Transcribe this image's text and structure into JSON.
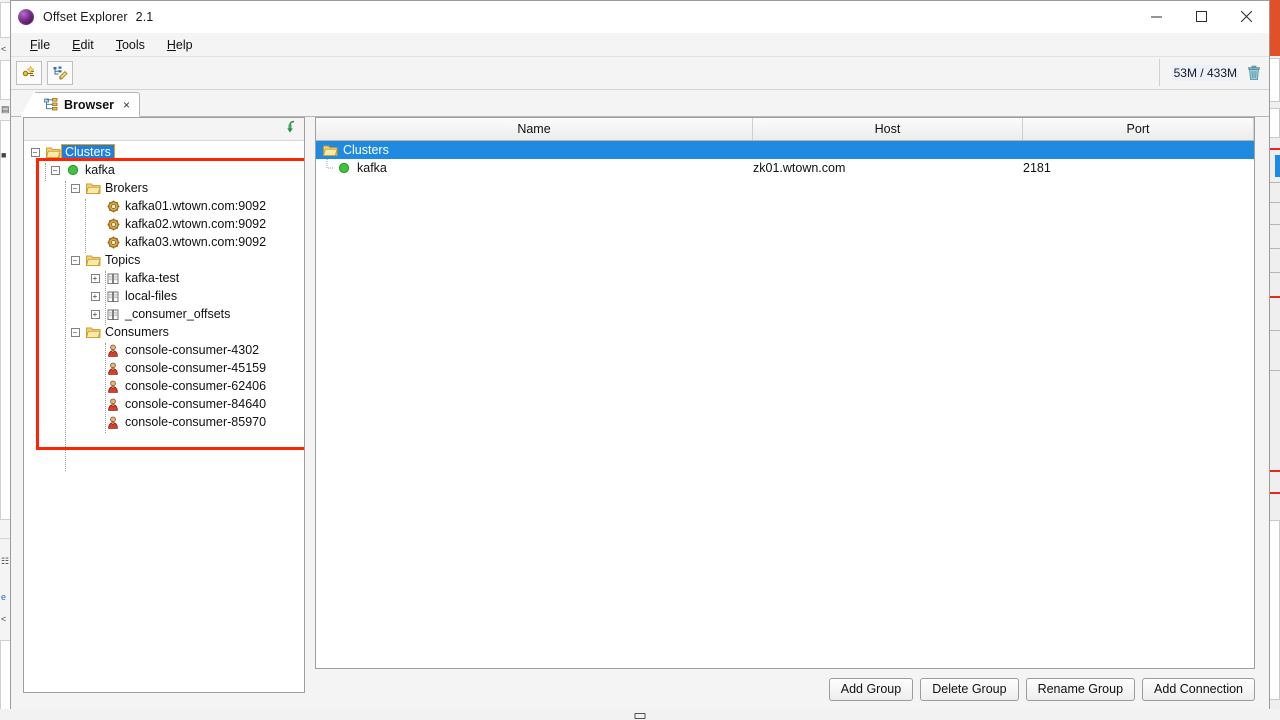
{
  "window": {
    "title": "Offset Explorer",
    "version": "2.1",
    "icon": "app-globe-icon",
    "controls": {
      "minimize": "minimize-icon",
      "maximize": "maximize-icon",
      "close": "close-icon"
    }
  },
  "menubar": {
    "items": [
      {
        "label": "File",
        "mnemonic": "F"
      },
      {
        "label": "Edit",
        "mnemonic": "E"
      },
      {
        "label": "Tools",
        "mnemonic": "T"
      },
      {
        "label": "Help",
        "mnemonic": "H"
      }
    ]
  },
  "toolbar": {
    "buttons": [
      {
        "name": "add-connection-toolbar-button",
        "icon": "connection-plug-icon"
      },
      {
        "name": "edit-properties-toolbar-button",
        "icon": "tree-pencil-icon"
      }
    ],
    "memory": {
      "text": "53M / 433M",
      "used": "53M",
      "total": "433M",
      "icon": "trash-icon"
    }
  },
  "tabs": [
    {
      "label": "Browser",
      "icon": "browser-tree-icon",
      "close": "×",
      "active": true
    }
  ],
  "tree_panel": {
    "toolbar_icon": "collapse-all-green-arrow-icon",
    "root": {
      "label": "Clusters",
      "icon": "folder-open-icon",
      "selected": true,
      "expanded": true
    },
    "nodes": [
      {
        "label": "kafka",
        "icon": "green-circle-icon",
        "depth": 1,
        "expander": "−"
      },
      {
        "label": "Brokers",
        "icon": "folder-open-icon",
        "depth": 2,
        "expander": "−"
      },
      {
        "label": "kafka01.wtown.com:9092",
        "icon": "gear-icon",
        "depth": 3,
        "expander": ""
      },
      {
        "label": "kafka02.wtown.com:9092",
        "icon": "gear-icon",
        "depth": 3,
        "expander": ""
      },
      {
        "label": "kafka03.wtown.com:9092",
        "icon": "gear-icon",
        "depth": 3,
        "expander": ""
      },
      {
        "label": "Topics",
        "icon": "folder-open-icon",
        "depth": 2,
        "expander": "−"
      },
      {
        "label": "kafka-test",
        "icon": "book-icon",
        "depth": 3,
        "expander": "+"
      },
      {
        "label": "local-files",
        "icon": "book-icon",
        "depth": 3,
        "expander": "+"
      },
      {
        "label": "_consumer_offsets",
        "icon": "book-icon",
        "depth": 3,
        "expander": "+"
      },
      {
        "label": "Consumers",
        "icon": "folder-open-icon",
        "depth": 2,
        "expander": "−"
      },
      {
        "label": "console-consumer-4302",
        "icon": "consumer-person-icon",
        "depth": 3,
        "expander": ""
      },
      {
        "label": "console-consumer-45159",
        "icon": "consumer-person-icon",
        "depth": 3,
        "expander": ""
      },
      {
        "label": "console-consumer-62406",
        "icon": "consumer-person-icon",
        "depth": 3,
        "expander": ""
      },
      {
        "label": "console-consumer-84640",
        "icon": "consumer-person-icon",
        "depth": 3,
        "expander": ""
      },
      {
        "label": "console-consumer-85970",
        "icon": "consumer-person-icon",
        "depth": 3,
        "expander": ""
      }
    ],
    "annotation": {
      "shape": "rectangle",
      "color": "#fe2600"
    }
  },
  "table": {
    "columns": [
      {
        "key": "name",
        "label": "Name"
      },
      {
        "key": "host",
        "label": "Host"
      },
      {
        "key": "port",
        "label": "Port"
      }
    ],
    "rows": [
      {
        "name": "Clusters",
        "host": "",
        "port": "",
        "icon": "folder-open-icon",
        "selected": true,
        "indent": 0
      },
      {
        "name": "kafka",
        "host": "zk01.wtown.com",
        "port": "2181",
        "icon": "green-circle-icon",
        "selected": false,
        "indent": 1
      }
    ]
  },
  "footer": {
    "buttons": [
      {
        "label": "Add Group",
        "name": "add-group-button"
      },
      {
        "label": "Delete Group",
        "name": "delete-group-button"
      },
      {
        "label": "Rename Group",
        "name": "rename-group-button"
      },
      {
        "label": "Add Connection",
        "name": "add-connection-button"
      }
    ]
  },
  "colors": {
    "selection_blue": "#1f8ae0",
    "annotation_red": "#fe2600",
    "selection_outline": "#f0a000",
    "status_green": "#33cc33",
    "folder_yellow": "#f7c843",
    "background": "#f4f4f4"
  }
}
